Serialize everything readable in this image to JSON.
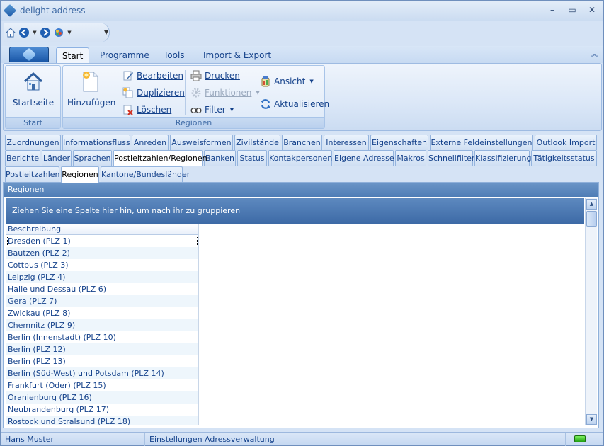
{
  "window": {
    "title": "delight address"
  },
  "window_controls": {
    "minimize": "–",
    "restore": "▭",
    "close": "✕"
  },
  "ribbon_tabs": [
    "Start",
    "Programme",
    "Tools",
    "Import & Export"
  ],
  "ribbon": {
    "groups": {
      "start": {
        "label": "Start",
        "startseite": "Startseite"
      },
      "regionen": {
        "label": "Regionen",
        "hinzufuegen": "Hinzufügen",
        "bearbeiten": "Bearbeiten",
        "duplizieren": "Duplizieren",
        "loeschen": "Löschen",
        "drucken": "Drucken",
        "funktionen": "Funktionen",
        "filter": "Filter",
        "ansicht": "Ansicht",
        "aktualisieren": "Aktualisieren"
      }
    }
  },
  "tabs_row1": [
    "Zuordnungen",
    "Informationsfluss",
    "Anreden",
    "Ausweisformen",
    "Zivilstände",
    "Branchen",
    "Interessen",
    "Eigenschaften",
    "Externe Feldeinstellungen",
    "Outlook Import"
  ],
  "tabs_row2": [
    "Berichte",
    "Länder",
    "Sprachen",
    "Postleitzahlen/Regionen",
    "Banken",
    "Status",
    "Kontakpersonen",
    "Eigene Adresse",
    "Makros",
    "Schnellfilter",
    "Klassifizierung",
    "Tätigkeitsstatus"
  ],
  "tabs_row3": [
    "Postleitzahlen",
    "Regionen",
    "Kantone/Bundesländer"
  ],
  "panel": {
    "title": "Regionen",
    "group_hint": "Ziehen Sie eine Spalte hier hin, um nach ihr zu gruppieren",
    "column": "Beschreibung",
    "rows": [
      "Dresden (PLZ 1)",
      "Bautzen (PLZ 2)",
      "Cottbus (PLZ 3)",
      "Leipzig (PLZ 4)",
      "Halle und Dessau (PLZ 6)",
      "Gera (PLZ 7)",
      "Zwickau (PLZ 8)",
      "Chemnitz (PLZ 9)",
      "Berlin (Innenstadt) (PLZ 10)",
      "Berlin (PLZ 12)",
      "Berlin (PLZ 13)",
      "Berlin (Süd-West) und Potsdam (PLZ 14)",
      "Frankfurt (Oder) (PLZ 15)",
      "Oranienburg (PLZ 16)",
      "Neubrandenburg (PLZ 17)",
      "Rostock und Stralsund (PLZ 18)"
    ]
  },
  "status": {
    "user": "Hans Muster",
    "message": "Einstellungen Adressverwaltung"
  }
}
